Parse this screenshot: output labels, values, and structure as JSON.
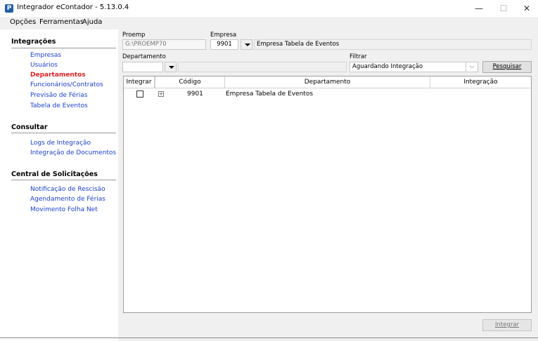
{
  "window": {
    "title": "Integrador eContador - 5.13.0.4",
    "icon_glyph": "P",
    "controls": {
      "minimize": "—",
      "maximize": "☐",
      "close": "✕"
    }
  },
  "menubar": {
    "items": [
      "Opções",
      "Ferramentas",
      "Ajuda"
    ]
  },
  "sidebar": {
    "sections": [
      {
        "title": "Integrações",
        "items": [
          {
            "label": "Empresas",
            "active": false
          },
          {
            "label": "Usuários",
            "active": false
          },
          {
            "label": "Departamentos",
            "active": true
          },
          {
            "label": "Funcionários/Contratos",
            "active": false
          },
          {
            "label": "Previsão de Férias",
            "active": false
          },
          {
            "label": "Tabela de Eventos",
            "active": false
          }
        ]
      },
      {
        "title": "Consultar",
        "items": [
          {
            "label": "Logs de Integração",
            "active": false
          },
          {
            "label": "Integração de Documentos",
            "active": false
          }
        ]
      },
      {
        "title": "Central de Solicitações",
        "items": [
          {
            "label": "Notificação de Rescisão",
            "active": false
          },
          {
            "label": "Agendamento de Férias",
            "active": false
          },
          {
            "label": "Movimento Folha Net",
            "active": false
          }
        ]
      }
    ]
  },
  "form": {
    "proemp_label": "Proemp",
    "proemp_value": "G:\\PROEMP70",
    "empresa_label": "Empresa",
    "empresa_code": "9901",
    "empresa_name": "Empresa Tabela de Eventos",
    "departamento_label": "Departamento",
    "departamento_code": "",
    "departamento_name": "",
    "filtrar_label": "Filtrar",
    "filtrar_value": "Aguardando Integração",
    "pesquisar_label": "Pesquisar"
  },
  "grid": {
    "columns": [
      "Integrar",
      "Código",
      "Departamento",
      "Integração"
    ],
    "rows": [
      {
        "integrar": false,
        "expand": "+",
        "codigo": "9901",
        "departamento": "Empresa Tabela de Eventos",
        "integracao": ""
      }
    ]
  },
  "footer": {
    "integrar_label": "Integrar"
  },
  "colors": {
    "link": "#1a3fd0",
    "active_link": "#e02020",
    "panel_bg": "#f0f0f0"
  }
}
